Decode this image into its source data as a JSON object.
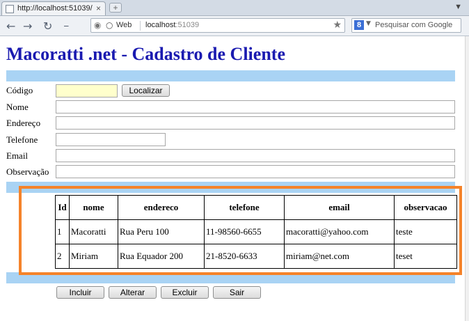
{
  "browser": {
    "tab_title": "http://localhost:51039/",
    "tab_close": "×",
    "new_tab": "+",
    "omnibox_label": "Web",
    "url_host": "localhost",
    "url_port": ":51039",
    "search_placeholder": "Pesquisar com Google",
    "search_engine_letter": "8"
  },
  "page": {
    "title": "Macoratti .net - Cadastro de Cliente"
  },
  "form": {
    "codigo_label": "Código",
    "codigo_value": "",
    "localizar_label": "Localizar",
    "nome_label": "Nome",
    "nome_value": "",
    "endereco_label": "Endereço",
    "endereco_value": "",
    "telefone_label": "Telefone",
    "telefone_value": "",
    "email_label": "Email",
    "email_value": "",
    "observacao_label": "Observação",
    "observacao_value": ""
  },
  "grid": {
    "headers": [
      "Id",
      "nome",
      "endereco",
      "telefone",
      "email",
      "observacao"
    ],
    "rows": [
      [
        "1",
        "Macoratti",
        "Rua Peru 100",
        "11-98560-6655",
        "macoratti@yahoo.com",
        "teste"
      ],
      [
        "2",
        "Miriam",
        "Rua Equador 200",
        "21-8520-6633",
        "miriam@net.com",
        "teset"
      ]
    ]
  },
  "actions": {
    "incluir": "Incluir",
    "alterar": "Alterar",
    "excluir": "Excluir",
    "sair": "Sair"
  },
  "colors": {
    "title": "#1a1ab0",
    "band": "#a9d3f4",
    "frame": "#f5832a",
    "codigo_bg": "#ffffcc"
  }
}
